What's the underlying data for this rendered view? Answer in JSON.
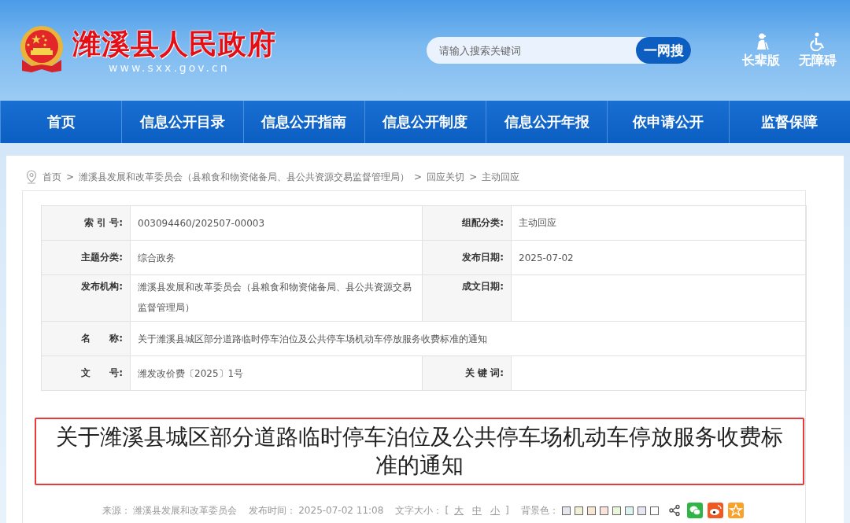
{
  "header": {
    "site_name": "潍溪县人民政府",
    "site_url": "www.sxx.gov.cn",
    "search": {
      "placeholder": "请输入搜索关键词",
      "button": "一网搜"
    },
    "tools": [
      {
        "label": "长辈版",
        "kind": "elder"
      },
      {
        "label": "无障碍",
        "kind": "accessible"
      }
    ]
  },
  "nav": [
    {
      "label": "首页"
    },
    {
      "label": "信息公开目录"
    },
    {
      "label": "信息公开指南"
    },
    {
      "label": "信息公开制度"
    },
    {
      "label": "信息公开年报"
    },
    {
      "label": "依申请公开"
    },
    {
      "label": "监督保障"
    }
  ],
  "breadcrumb": {
    "separator": ">",
    "items": [
      "首页",
      "潍溪县发展和改革委员会（县粮食和物资储备局、县公共资源交易监督管理局）",
      "回应关切",
      "主动回应"
    ]
  },
  "info_table": [
    {
      "cells": [
        {
          "label": "索 引 号:",
          "value": "003094460/202507-00003"
        },
        {
          "label": "组配分类:",
          "value": "主动回应"
        }
      ]
    },
    {
      "cells": [
        {
          "label": "主题分类:",
          "value": "综合政务"
        },
        {
          "label": "发布日期:",
          "value": "2025-07-02"
        }
      ]
    },
    {
      "cells": [
        {
          "label": "发布机构:",
          "value": "潍溪县发展和改革委员会（县粮食和物资储备局、县公共资源交易监督管理局）"
        },
        {
          "label": "成文日期:"
        }
      ]
    },
    {
      "cells": [
        {
          "label": "名　　称:",
          "value": "关于潍溪县城区部分道路临时停车泊位及公共停车场机动车停放服务收费标准的通知"
        }
      ]
    },
    {
      "cells": [
        {
          "label": "文　　号:",
          "value": "潍发改价费〔2025〕1号"
        },
        {
          "label": "关 键 词:"
        }
      ]
    }
  ],
  "article": {
    "title": "关于潍溪县城区部分道路临时停车泊位及公共停车场机动车停放服务收费标准的通知"
  },
  "meta": {
    "source_label": "来源：",
    "source": "潍溪县发展和改革委员会",
    "time_label": "发布时间：",
    "time": "2025-07-02 11:08",
    "size_label": "文字大小：",
    "size_open": "[",
    "sizes": [
      "大",
      "中",
      "小"
    ],
    "size_close": "]",
    "bg_label": "背景色：",
    "bg_colors": [
      {
        "color": "#e6e6ee"
      },
      {
        "color": "#f3f0d8"
      },
      {
        "color": "#f6e6d2"
      },
      {
        "color": "#fde2dc"
      },
      {
        "color": "#eaf6d8"
      },
      {
        "color": "#dcf4f0"
      },
      {
        "color": "#e6e6f2"
      },
      {
        "color": "#ffffff"
      }
    ],
    "share": [
      {
        "kind": "share"
      },
      {
        "kind": "wechat"
      },
      {
        "kind": "weibo"
      },
      {
        "kind": "favorite"
      }
    ]
  }
}
